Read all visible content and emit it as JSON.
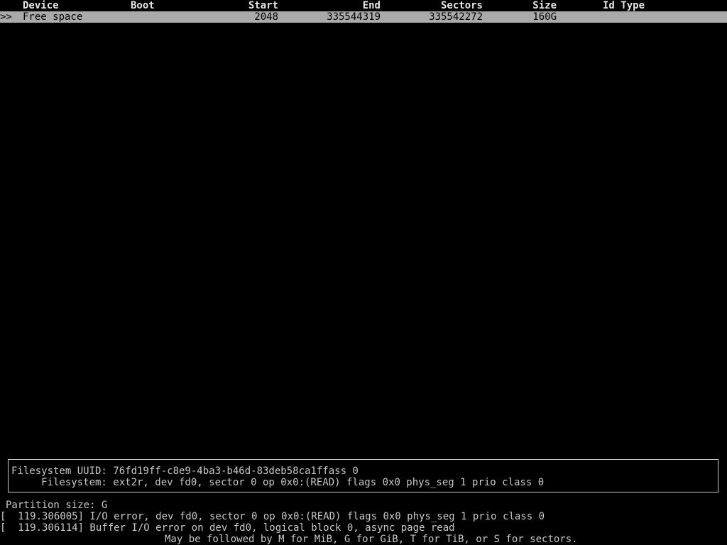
{
  "table": {
    "headers": {
      "device": "Device",
      "boot": "Boot",
      "start": "Start",
      "end": "End",
      "sectors": "Sectors",
      "size": "Size",
      "id_type": "Id Type"
    },
    "rows": [
      {
        "cursor": ">>",
        "device": "Free space",
        "boot": "",
        "start": "2048",
        "end": "335544319",
        "sectors": "335542272",
        "size": "160G",
        "id_type": ""
      }
    ]
  },
  "info_box": {
    "line1": "Filesystem UUID: 76fd19ff-c8e9-4ba3-b46d-83deb58ca1ffass 0",
    "line2": "     Filesystem: ext2r, dev fd0, sector 0 op 0x0:(READ) flags 0x0 phys_seg 1 prio class 0"
  },
  "prompt": {
    "partition_size": "Partition size: G"
  },
  "kernel_messages": [
    "[  119.306005] I/O error, dev fd0, sector 0 op 0x0:(READ) flags 0x0 phys_seg 1 prio class 0",
    "[  119.306114] Buffer I/O error on dev fd0, logical block 0, async page read"
  ],
  "help": {
    "text": "May be followed by M for MiB, G for GiB, T for TiB, or S for sectors."
  },
  "colors": {
    "background": "#000000",
    "foreground": "#c8c8c8",
    "selection": "#aaaaaa"
  }
}
